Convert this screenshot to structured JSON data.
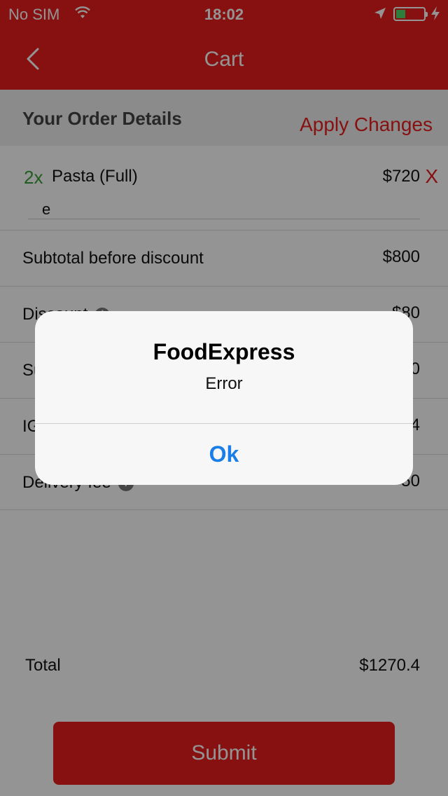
{
  "status_bar": {
    "carrier": "No SIM",
    "time": "18:02",
    "battery_level": 0.35
  },
  "nav": {
    "title": "Cart",
    "back_icon": "chevron-left-icon"
  },
  "order": {
    "header_title": "Your Order Details",
    "apply_label": "Apply Changes",
    "item": {
      "qty": "2x",
      "name": "Pasta (Full)",
      "price": "$720",
      "remove_label": "X",
      "note": "e"
    },
    "summary": [
      {
        "label": "Subtotal before discount",
        "value": "$800",
        "info": false
      },
      {
        "label": "Discount",
        "value": "$80",
        "info": true
      },
      {
        "label": "Su",
        "value": "0",
        "info": false
      },
      {
        "label": "IG",
        "value": "4",
        "info": false
      },
      {
        "label": "Delivery fee",
        "value": "50",
        "info": true
      }
    ],
    "total_label": "Total",
    "total_value": "$1270.4",
    "submit_label": "Submit"
  },
  "alert": {
    "title": "FoodExpress",
    "message": "Error",
    "ok_label": "Ok"
  },
  "colors": {
    "brand": "#e81e1e",
    "qty": "#3aa03a",
    "alert_button": "#1a7ee8"
  }
}
